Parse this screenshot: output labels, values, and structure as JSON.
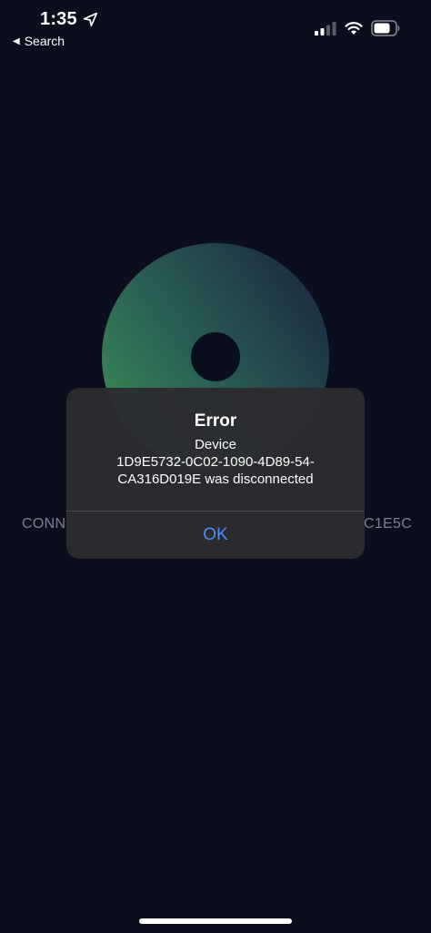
{
  "status_bar": {
    "time": "1:35",
    "back_label": "Search",
    "back_caret": "◀",
    "icons": [
      "location-arrow-icon",
      "cellular-signal-icon",
      "wifi-icon",
      "battery-icon"
    ]
  },
  "background": {
    "left_text": "CONN",
    "right_text": "C1E5C",
    "disc_colors": {
      "green": "#2f7a4e",
      "teal": "#254f52",
      "dark": "#1d2b3e",
      "hole": "#0b0e1d"
    }
  },
  "alert": {
    "title": "Error",
    "message_line1": "Device",
    "message_line2": "1D9E5732-0C02-1090-4D89-54-",
    "message_line3": "CA316D019E was disconnected",
    "ok_label": "OK",
    "button_color": "#4a8ff7"
  },
  "colors": {
    "background": "#0b0e1d",
    "alert_bg": "#2c2c30",
    "secondary_text": "#7a7f94"
  }
}
